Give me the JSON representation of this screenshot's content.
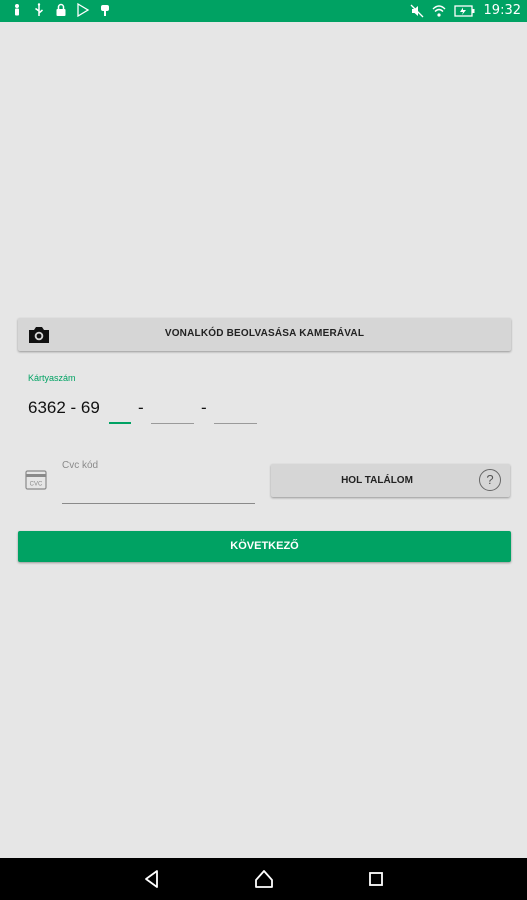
{
  "status_bar": {
    "time": "19:32",
    "left_icons": [
      "person-icon",
      "usb-icon",
      "lock-icon",
      "play-store-icon",
      "android-debug-icon"
    ],
    "right_icons": [
      "mute-icon",
      "wifi-icon",
      "battery-icon"
    ]
  },
  "scan": {
    "label": "VONALKÓD BEOLVASÁSA KAMERÁVAL",
    "icon": "camera-icon"
  },
  "card": {
    "label": "Kártyaszám",
    "prefix": "6362 - 69",
    "separator": "-",
    "segments": [
      {
        "value": "",
        "active": true
      },
      {
        "value": "",
        "active": false
      },
      {
        "value": "",
        "active": false
      }
    ]
  },
  "cvc": {
    "label": "Cvc kód",
    "value": "",
    "icon": "cvc-card-icon",
    "icon_text": "CVC"
  },
  "help": {
    "label": "HOL TALÁLOM",
    "icon_glyph": "?"
  },
  "next": {
    "label": "KÖVETKEZŐ"
  },
  "colors": {
    "accent": "#00a263",
    "background": "#e6e6e6",
    "button_gray": "#d6d6d6",
    "nav_bar": "#000000"
  }
}
